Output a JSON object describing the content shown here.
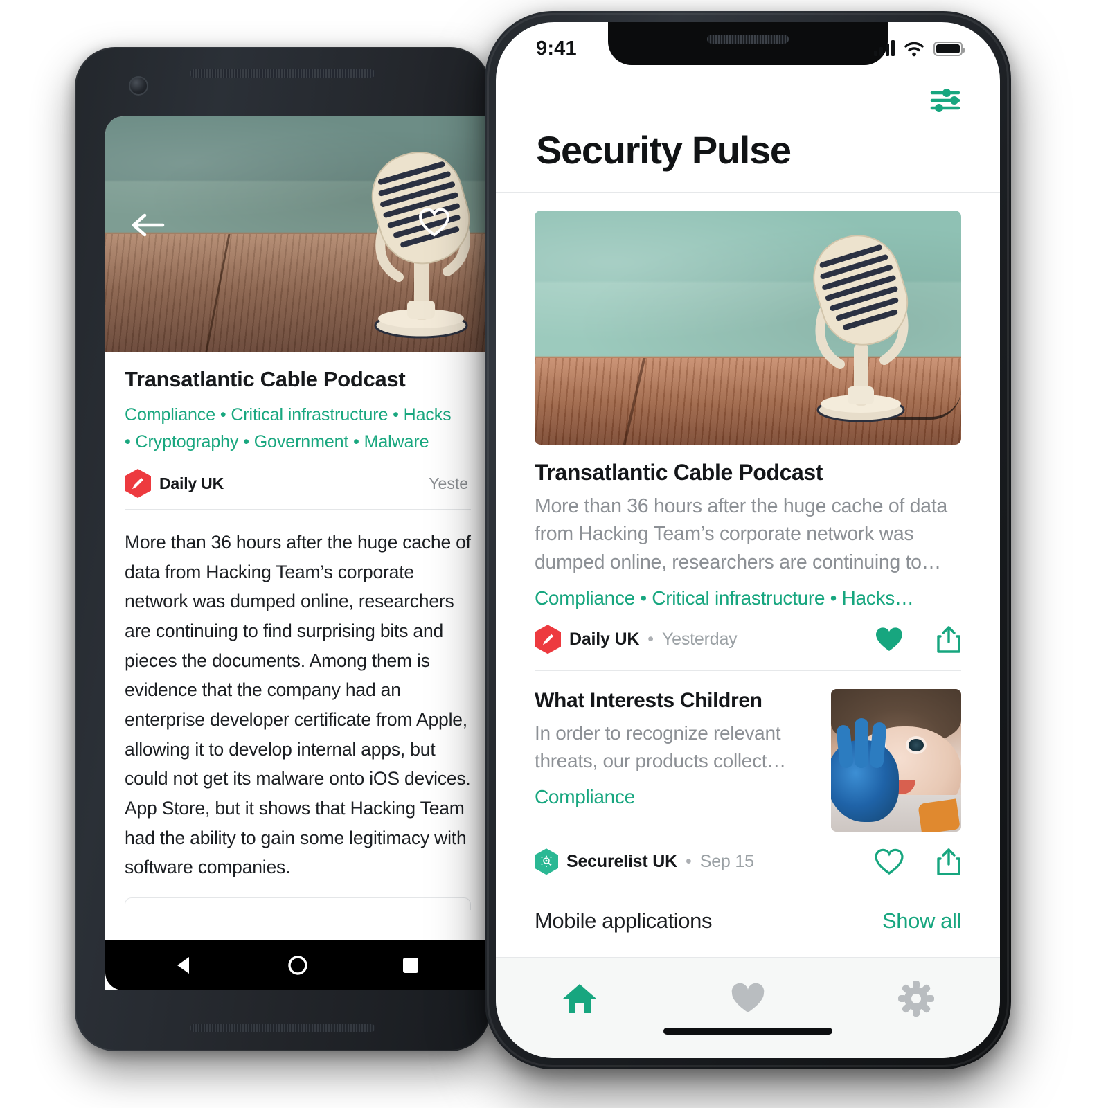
{
  "android_phone": {
    "name": "android-device",
    "detail_screen": {
      "back_icon": "arrow-left-icon",
      "favorite_icon": "heart-outline-icon",
      "hero_alt": "retro-microphone-on-wooden-table",
      "title": "Transatlantic Cable Podcast",
      "tags": "Compliance • Critical infrastructure • Hacks… • Cryptography • Government • Malware",
      "tags_line1": "Compliance • Critical infrastructure • Hacks",
      "tags_line2": "• Cryptography • Government • Malware",
      "source": "Daily UK",
      "source_icon": "pencil-hexagon-icon",
      "timestamp": "Yeste",
      "body": "More than 36 hours after the huge cache of data from Hacking Team’s corporate network was dumped online, researchers are continuing to find surprising bits and pieces the documents. Among them is evidence that the company had an enterprise developer certificate from Apple, allowing it to develop internal apps, but could not get its malware onto iOS devices. App Store, but it shows that Hacking Team had the ability to gain some legitimacy with software companies."
    },
    "navbar": {
      "back": "triangle-back-icon",
      "home": "circle-home-icon",
      "recents": "square-recents-icon"
    }
  },
  "ios_phone": {
    "name": "ios-device",
    "statusbar": {
      "time": "9:41",
      "cellular_icon": "signal-bars-icon",
      "wifi_icon": "wifi-icon",
      "battery_icon": "battery-full-icon"
    },
    "topbar": {
      "filter_icon": "sliders-filter-icon"
    },
    "header": {
      "title": "Security Pulse"
    },
    "feed": {
      "cards": [
        {
          "hero_alt": "retro-microphone-on-wooden-table",
          "title": "Transatlantic Cable Podcast",
          "summary": "More than 36 hours after the huge cache of data from Hacking Team’s corporate network was dumped online, researchers are continuing to…",
          "tags": "Compliance • Critical infrastructure • Hacks…",
          "source": "Daily UK",
          "source_icon": "pencil-hexagon-icon",
          "separator": "•",
          "timestamp": "Yesterday",
          "favorite_icon": "heart-filled-icon",
          "favorite_state": "on",
          "share_icon": "share-up-icon"
        },
        {
          "title": "What Interests Children",
          "summary": "In order to recognize relevant threats, our products collect…",
          "tags": "Compliance",
          "thumb_alt": "child-with-blue-painted-hand",
          "source": "Securelist UK",
          "source_icon": "securelist-hexagon-icon",
          "separator": "•",
          "timestamp": "Sep 15",
          "favorite_icon": "heart-outline-icon",
          "favorite_state": "off",
          "share_icon": "share-up-icon"
        }
      ]
    },
    "section": {
      "title": "Mobile applications",
      "link": "Show all"
    },
    "tabbar": {
      "items": [
        {
          "icon": "home-icon",
          "label": "Home",
          "active": true
        },
        {
          "icon": "heart-icon",
          "label": "Favorites",
          "active": false
        },
        {
          "icon": "gear-icon",
          "label": "Settings",
          "active": false
        }
      ]
    }
  },
  "colors": {
    "accent_green": "#17a67f",
    "source_red": "#ed3a3f",
    "source_green": "#2bb894",
    "text_primary": "#141619",
    "text_muted": "#8c9095",
    "divider": "#e6e8ea",
    "tabbar_bg": "#f6f8f7",
    "tabbar_inactive": "#b9bdc0"
  }
}
